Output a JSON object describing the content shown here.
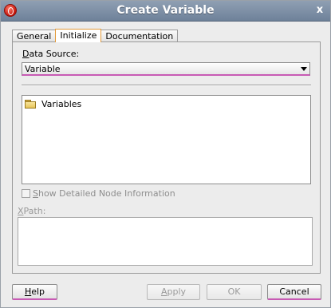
{
  "window": {
    "title": "Create Variable",
    "close_label": "x",
    "app_icon": "oracle-logo-icon"
  },
  "tabs": [
    {
      "label": "General",
      "active": false
    },
    {
      "label": "Initialize",
      "active": true
    },
    {
      "label": "Documentation",
      "active": false
    }
  ],
  "data_source": {
    "label_mnemonic": "D",
    "label_rest": "ata Source:",
    "selected": "Variable"
  },
  "tree": {
    "items": [
      {
        "label": "Variables",
        "icon": "folder-icon"
      }
    ]
  },
  "show_detailed": {
    "mnemonic": "S",
    "rest": "how Detailed Node Information",
    "checked": false,
    "enabled": false
  },
  "xpath": {
    "mnemonic": "X",
    "rest": "Path:",
    "value": ""
  },
  "buttons": {
    "help": {
      "mnemonic": "H",
      "rest": "elp"
    },
    "apply": {
      "mnemonic": "A",
      "rest": "pply"
    },
    "ok": "OK",
    "cancel": "Cancel"
  },
  "colors": {
    "title_bar": "#7d8ea6",
    "focus_underline": "#c85ab4",
    "active_tab_border": "#e39a3a"
  }
}
